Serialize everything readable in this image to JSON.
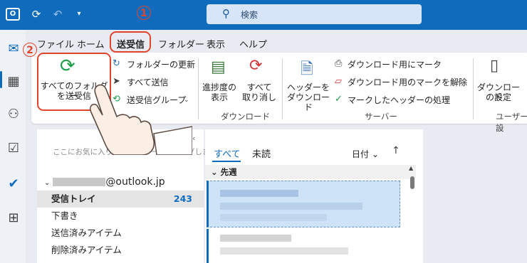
{
  "titlebar": {
    "app_icon_text": "O",
    "search_placeholder": "検索"
  },
  "tabs": [
    {
      "label": "ファイル"
    },
    {
      "label": "ホーム"
    },
    {
      "label": "送受信"
    },
    {
      "label": "フォルダー"
    },
    {
      "label": "表示"
    },
    {
      "label": "ヘルプ"
    }
  ],
  "ribbon": {
    "send_all_label_1": "すべてのフォルダー",
    "send_all_label_2": "を送受信",
    "update_folder": "フォルダーの更新",
    "send_all": "すべて送信",
    "send_receive_groups": "送受信グループ",
    "show_progress_1": "進捗度の",
    "show_progress_2": "表示",
    "cancel_all_1": "すべて",
    "cancel_all_2": "取り消し",
    "download_group": "ダウンロード",
    "download_headers_1": "ヘッダーを",
    "download_headers_2": "ダウンロード",
    "mark_download": "ダウンロード用にマーク",
    "unmark_download": "ダウンロード用のマークを解除",
    "process_marked": "マークしたヘッダーの処理",
    "server_group": "サーバー",
    "download_settings_1": "ダウンロード",
    "download_settings_2": "の設定",
    "user_group": "ユーザー設"
  },
  "folders": {
    "favorites_hint": "ここにお気に入りのフォルダーをドラッグします",
    "account": "@outlook.jp",
    "items": [
      {
        "label": "受信トレイ",
        "count": "243"
      },
      {
        "label": "下書き"
      },
      {
        "label": "送信済みアイテム"
      },
      {
        "label": "削除済みアイテム"
      }
    ]
  },
  "messages": {
    "tab_all": "すべて",
    "tab_unread": "未読",
    "sort_label": "日付",
    "group_header": "先週"
  },
  "annotations": {
    "one": "1",
    "two": "2"
  },
  "colors": {
    "accent": "#0f6cbd",
    "annotation": "#e0452b"
  }
}
